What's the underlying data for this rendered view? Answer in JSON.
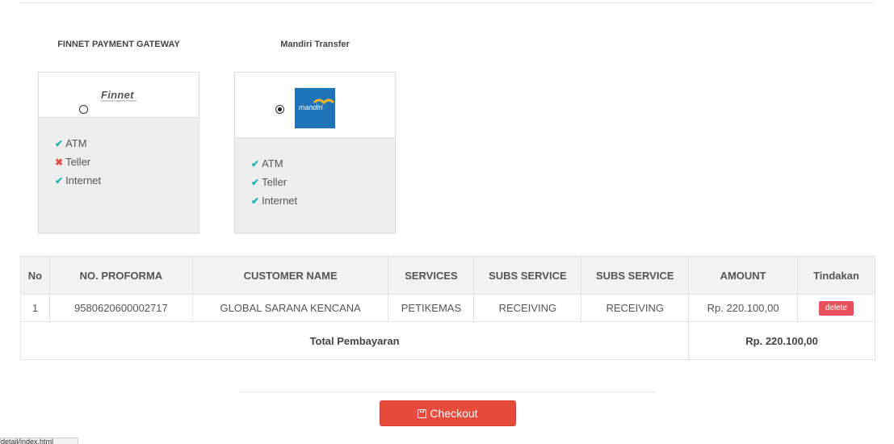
{
  "payment_methods": [
    {
      "title": "FINNET PAYMENT GATEWAY",
      "logo_text": "Finnet",
      "logo_subtext": "Electronic Payment Provider",
      "selected": false,
      "features": [
        {
          "label": "ATM",
          "available": true
        },
        {
          "label": "Teller",
          "available": false
        },
        {
          "label": "Internet",
          "available": true
        }
      ]
    },
    {
      "title": "Mandiri Transfer",
      "logo_text": "mandiri",
      "selected": true,
      "features": [
        {
          "label": "ATM",
          "available": true
        },
        {
          "label": "Teller",
          "available": true
        },
        {
          "label": "Internet",
          "available": true
        }
      ]
    }
  ],
  "table": {
    "headers": [
      "No",
      "NO. PROFORMA",
      "CUSTOMER NAME",
      "SERVICES",
      "SUBS SERVICE",
      "SUBS SERVICE",
      "AMOUNT",
      "Tindakan"
    ],
    "rows": [
      {
        "no": "1",
        "proforma": "9580620600002717",
        "customer": "GLOBAL SARANA KENCANA",
        "services": "PETIKEMAS",
        "subs_service_1": "RECEIVING",
        "subs_service_2": "RECEIVING",
        "amount": "Rp. 220.100,00",
        "action": "delete"
      }
    ],
    "total_label": "Total Pembayaran",
    "total_amount": "Rp. 220.100,00"
  },
  "checkout_label": "Checkout",
  "status_tip": "detail/index.html",
  "colors": {
    "check": "#1fb5ad",
    "cross": "#e3504b",
    "checkout": "#e64b3c",
    "delete": "#e8505b",
    "mandiri_blue": "#1f73b8"
  },
  "icons": {
    "available": "check-icon",
    "unavailable": "cross-icon",
    "checkout": "floppy-disk-icon"
  }
}
